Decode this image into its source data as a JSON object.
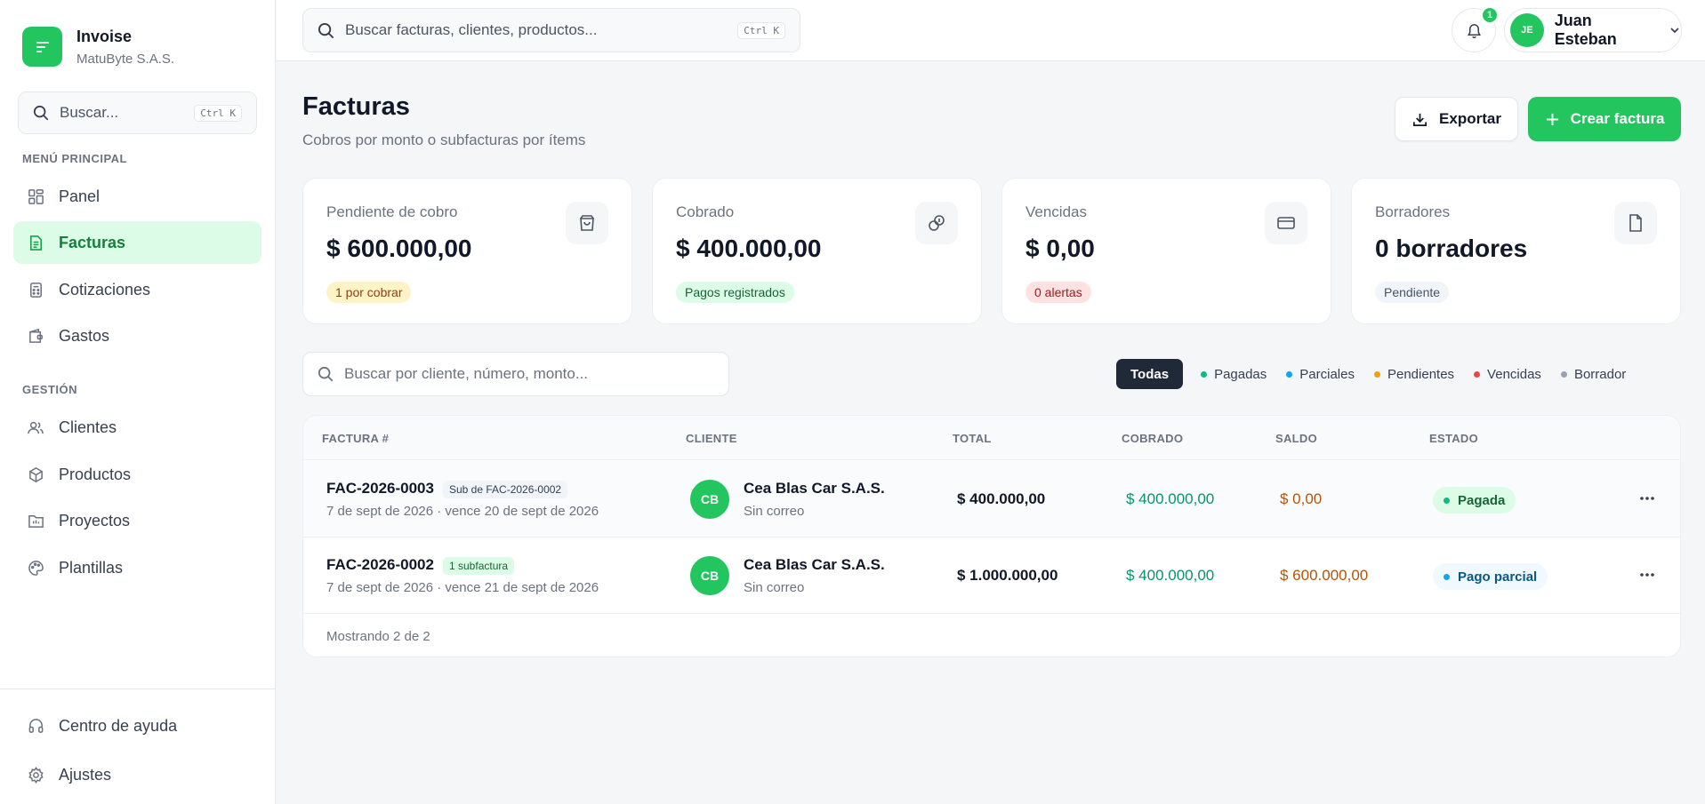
{
  "brand": {
    "name": "Invoise",
    "company": "MatuByte S.A.S."
  },
  "sidebar": {
    "search": {
      "placeholder": "Buscar...",
      "shortcut": "Ctrl K"
    },
    "main_label": "MENÚ PRINCIPAL",
    "main_items": [
      {
        "label": "Panel",
        "icon": "grid-icon"
      },
      {
        "label": "Facturas",
        "icon": "file-text-icon",
        "active": true
      },
      {
        "label": "Cotizaciones",
        "icon": "calculator-icon"
      },
      {
        "label": "Gastos",
        "icon": "wallet-icon"
      }
    ],
    "mgmt_label": "GESTIÓN",
    "mgmt_items": [
      {
        "label": "Clientes",
        "icon": "users-icon"
      },
      {
        "label": "Productos",
        "icon": "package-icon"
      },
      {
        "label": "Proyectos",
        "icon": "folder-icon"
      },
      {
        "label": "Plantillas",
        "icon": "palette-icon"
      }
    ],
    "bottom_items": [
      {
        "label": "Centro de ayuda",
        "icon": "headset-icon"
      },
      {
        "label": "Ajustes",
        "icon": "gear-icon"
      }
    ]
  },
  "topbar": {
    "search": {
      "placeholder": "Buscar facturas, clientes, productos...",
      "shortcut": "Ctrl K"
    },
    "notifications_count": "1",
    "user": {
      "initials": "JE",
      "name": "Juan Esteban"
    }
  },
  "header": {
    "title": "Facturas",
    "subtitle": "Cobros por monto o subfacturas por ítems",
    "export_label": "Exportar",
    "create_label": "Crear factura"
  },
  "cards": [
    {
      "label": "Pendiente de cobro",
      "value": "$ 600.000,00",
      "pill": "1 por cobrar",
      "icon": "shopping-bag-icon"
    },
    {
      "label": "Cobrado",
      "value": "$ 400.000,00",
      "pill": "Pagos registrados",
      "icon": "coins-icon"
    },
    {
      "label": "Vencidas",
      "value": "$ 0,00",
      "pill": "0 alertas",
      "icon": "credit-card-icon"
    },
    {
      "label": "Borradores",
      "value": "0 borradores",
      "pill": "Pendiente",
      "icon": "file-icon"
    }
  ],
  "list": {
    "search_placeholder": "Buscar por cliente, número, monto...",
    "filters": [
      {
        "label": "Todas",
        "active": true
      },
      {
        "label": "Pagadas",
        "color": "#10b981"
      },
      {
        "label": "Parciales",
        "color": "#0ea5e9"
      },
      {
        "label": "Pendientes",
        "color": "#f59e0b"
      },
      {
        "label": "Vencidas",
        "color": "#ef4444"
      },
      {
        "label": "Borrador",
        "color": "#94a3b8"
      }
    ]
  },
  "table": {
    "columns": [
      "FACTURA #",
      "CLIENTE",
      "TOTAL",
      "COBRADO",
      "SALDO",
      "ESTADO"
    ],
    "rows": [
      {
        "number": "FAC-2026-0003",
        "tag": "Sub de FAC-2026-0002",
        "dates": "7 de sept de 2026 · vence 20 de sept de 2026",
        "client_initials": "CB",
        "client_name": "Cea Blas Car S.A.S.",
        "client_email": "Sin correo",
        "total": "$ 400.000,00",
        "collected": "$ 400.000,00",
        "balance": "$ 0,00",
        "status": "Pagada"
      },
      {
        "number": "FAC-2026-0002",
        "tag": "1 subfactura",
        "dates": "7 de sept de 2026 · vence 21 de sept de 2026",
        "client_initials": "CB",
        "client_name": "Cea Blas Car S.A.S.",
        "client_email": "Sin correo",
        "total": "$ 1.000.000,00",
        "collected": "$ 400.000,00",
        "balance": "$ 600.000,00",
        "status": "Pago parcial"
      }
    ],
    "footer": "Mostrando 2 de 2"
  },
  "colors": {
    "accent": "#22c55e",
    "active_bg": "#dcfce7",
    "collected_text": "#059669",
    "balance_text": "#b45309"
  }
}
